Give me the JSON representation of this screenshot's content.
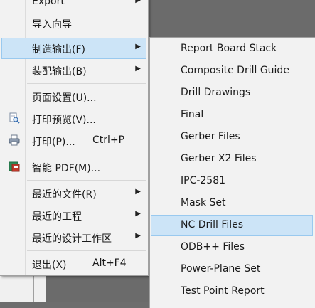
{
  "file_menu": {
    "items": [
      {
        "label": "Export",
        "arrow": "▶"
      },
      {
        "label": "导入向导"
      },
      {
        "label": "制造输出(F)",
        "arrow": "▶"
      },
      {
        "label": "装配输出(B)",
        "arrow": "▶"
      },
      {
        "label": "页面设置(U)..."
      },
      {
        "label": "打印预览(V)..."
      },
      {
        "label": "打印(P)...",
        "shortcut": "Ctrl+P"
      },
      {
        "label": "智能 PDF(M)..."
      },
      {
        "label": "最近的文件(R)",
        "arrow": "▶"
      },
      {
        "label": "最近的工程",
        "arrow": "▶"
      },
      {
        "label": "最近的设计工作区",
        "arrow": "▶"
      },
      {
        "label": "退出(X)",
        "shortcut": "Alt+F4"
      }
    ]
  },
  "fabrication_submenu": {
    "items": [
      {
        "label": "Report Board Stack"
      },
      {
        "label": "Composite Drill Guide"
      },
      {
        "label": "Drill Drawings"
      },
      {
        "label": "Final"
      },
      {
        "label": "Gerber Files"
      },
      {
        "label": "Gerber X2 Files"
      },
      {
        "label": "IPC-2581"
      },
      {
        "label": "Mask Set"
      },
      {
        "label": "NC Drill Files"
      },
      {
        "label": "ODB++ Files"
      },
      {
        "label": "Power-Plane Set"
      },
      {
        "label": "Test Point Report"
      }
    ]
  },
  "colors": {
    "highlight": "#cce4f7",
    "highlight_border": "#99c9ef",
    "menu_bg": "#f2f2f2",
    "background": "#6b6b6b"
  },
  "icons": [
    "print-preview-icon",
    "print-icon",
    "smart-pdf-icon"
  ]
}
